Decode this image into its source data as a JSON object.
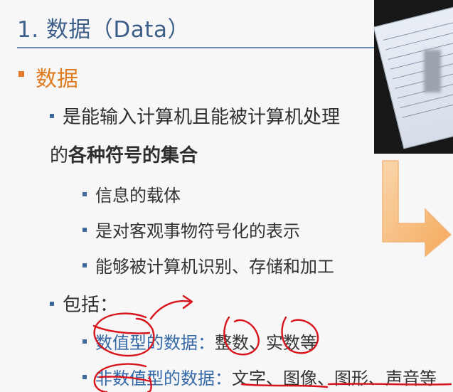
{
  "slide": {
    "title": "1. 数据（Data）",
    "section_heading": "数据",
    "definition_line1": "是能输入计算机且能被计算机处理",
    "definition_line2_prefix": "的",
    "definition_line2_bold": "各种符号的集合",
    "sub_points": [
      "信息的载体",
      "是对客观事物符号化的表示",
      "能够被计算机识别、存储和加工"
    ],
    "includes_label": "包括：",
    "includes_items": [
      {
        "term": "数值型的数据",
        "sep": "：",
        "examples": "整数、实数等"
      },
      {
        "term": "非数值型的数据",
        "sep": "：",
        "examples": "文字、图像、图形、声音等"
      }
    ]
  },
  "colors": {
    "title_blue": "#3c5e88",
    "heading_orange": "#e07a1f",
    "bullet_blue": "#3f6a9c",
    "ink_red": "#d8141d",
    "arrow_orange": "#f5a64e"
  }
}
